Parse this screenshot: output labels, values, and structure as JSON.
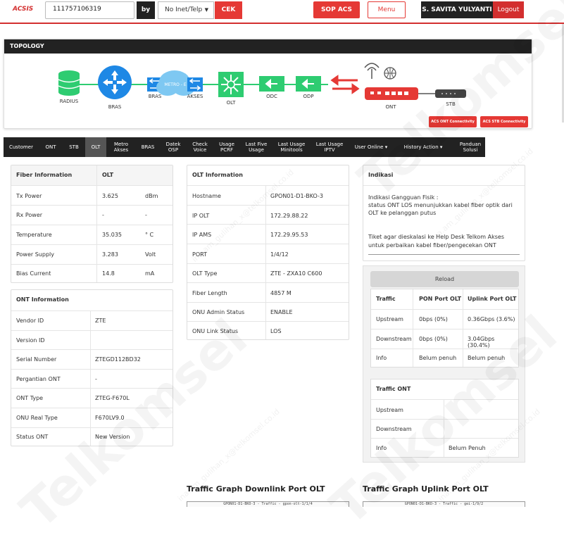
{
  "header": {
    "logo": "ACSIS",
    "search_value": "111757106319",
    "by_label": "by",
    "search_type": "No Inet/Telp",
    "cek_label": "CEK",
    "sop_label": "SOP ACS",
    "menu_label": "Menu",
    "user_name": "S. SAVITA YULYANTI",
    "logout_label": "Logout"
  },
  "topology": {
    "title": "TOPOLOGY",
    "nodes": {
      "radius": "RADIUS",
      "bras": "BRAS",
      "bras2": "BRAS",
      "metro": "METRO - E",
      "akses": "AKSES",
      "olt": "OLT",
      "odc": "ODC",
      "odp": "ODP",
      "ont": "ONT",
      "stb": "STB"
    },
    "acs_ont": "ACS ONT Connectivity",
    "acs_stb": "ACS STB Connectivity"
  },
  "tabs": {
    "customer": "Customer",
    "ont": "ONT",
    "stb": "STB",
    "olt": "OLT",
    "metro1": "Metro",
    "metro2": "Akses",
    "bras": "BRAS",
    "datek1": "Datek",
    "datek2": "OSP",
    "check1": "Check",
    "check2": "Voice",
    "usage1": "Usage",
    "usage2": "PCRF",
    "five1": "Last Five",
    "five2": "Usage",
    "lum1": "Last Usage",
    "lum2": "Minitools",
    "lui1": "Last Usage",
    "lui2": "IPTV",
    "user_online": "User Online",
    "history": "History Action",
    "panduan1": "Panduan",
    "panduan2": "Solusi"
  },
  "fiber": {
    "header_label": "Fiber Information",
    "header_value": "OLT",
    "rows": [
      {
        "label": "Tx Power",
        "value": "3.625",
        "unit": "dBm"
      },
      {
        "label": "Rx Power",
        "value": "-",
        "unit": "-"
      },
      {
        "label": "Temperature",
        "value": "35.035",
        "unit": "° C"
      },
      {
        "label": "Power Supply",
        "value": "3.283",
        "unit": "Volt"
      },
      {
        "label": "Bias Current",
        "value": "14.8",
        "unit": "mA"
      }
    ]
  },
  "ont_info": {
    "title": "ONT Information",
    "rows": [
      {
        "label": "Vendor ID",
        "value": "ZTE"
      },
      {
        "label": "Version ID",
        "value": ""
      },
      {
        "label": "Serial Number",
        "value": "ZTEGD112BD32"
      },
      {
        "label": "Pergantian ONT",
        "value": "-"
      },
      {
        "label": "ONT Type",
        "value": "ZTEG-F670L"
      },
      {
        "label": "ONU Real Type",
        "value": "F670LV9.0"
      },
      {
        "label": "Status ONT",
        "value": "New Version"
      }
    ]
  },
  "olt_info": {
    "title": "OLT Information",
    "rows": [
      {
        "label": "Hostname",
        "value": "GPON01-D1-BKO-3"
      },
      {
        "label": "IP OLT",
        "value": "172.29.88.22"
      },
      {
        "label": "IP AMS",
        "value": "172.29.95.53"
      },
      {
        "label": "PORT",
        "value": "1/4/12"
      },
      {
        "label": "OLT Type",
        "value": "ZTE - ZXA10 C600"
      },
      {
        "label": "Fiber Length",
        "value": "4857 M"
      },
      {
        "label": "ONU Admin Status",
        "value": "ENABLE"
      },
      {
        "label": "ONU Link Status",
        "value": "LOS"
      }
    ]
  },
  "indikasi": {
    "title": "Indikasi",
    "line1": "Indikasi Gangguan Fisik :",
    "line2": "status ONT LOS menunjukkan kabel fiber optik dari OLT ke pelanggan putus",
    "line3": "Tiket agar dieskalasi ke Help Desk Telkom Akses untuk perbaikan kabel fiber/pengecekan ONT"
  },
  "traffic": {
    "reload_label": "Reload",
    "col_traffic": "Traffic",
    "col_pon": "PON Port OLT",
    "col_uplink": "Uplink Port OLT",
    "rows": [
      {
        "label": "Upstream",
        "pon": "0bps (0%)",
        "uplink": "0.36Gbps (3.6%)"
      },
      {
        "label": "Downstream",
        "pon": "0bps (0%)",
        "uplink": "3.04Gbps (30.4%)"
      },
      {
        "label": "Info",
        "pon": "Belum penuh",
        "uplink": "Belum penuh"
      }
    ]
  },
  "traffic_ont": {
    "title": "Traffic ONT",
    "rows": [
      {
        "label": "Upstream",
        "value": ""
      },
      {
        "label": "Downstream",
        "value": ""
      },
      {
        "label": "Info",
        "value": "Belum Penuh"
      }
    ]
  },
  "graphs": {
    "downlink_title": "Traffic Graph Downlink Port OLT",
    "uplink_title": "Traffic Graph Uplink Port OLT",
    "downlink_caption": "GPON01-D1-BKO-3 - Traffic - gpon-olt-1/1/4",
    "uplink_caption": "GPON01-D1-BKO-3 - Traffic - gei-1/9/2"
  },
  "watermark": {
    "brand": "Telkomsel",
    "email": "ina.am_gulihan_x@telkomsel.co.id"
  },
  "colors": {
    "accent": "#e53935",
    "dark": "#222222",
    "node_blue": "#1e88e5",
    "node_green": "#2ecc71"
  }
}
